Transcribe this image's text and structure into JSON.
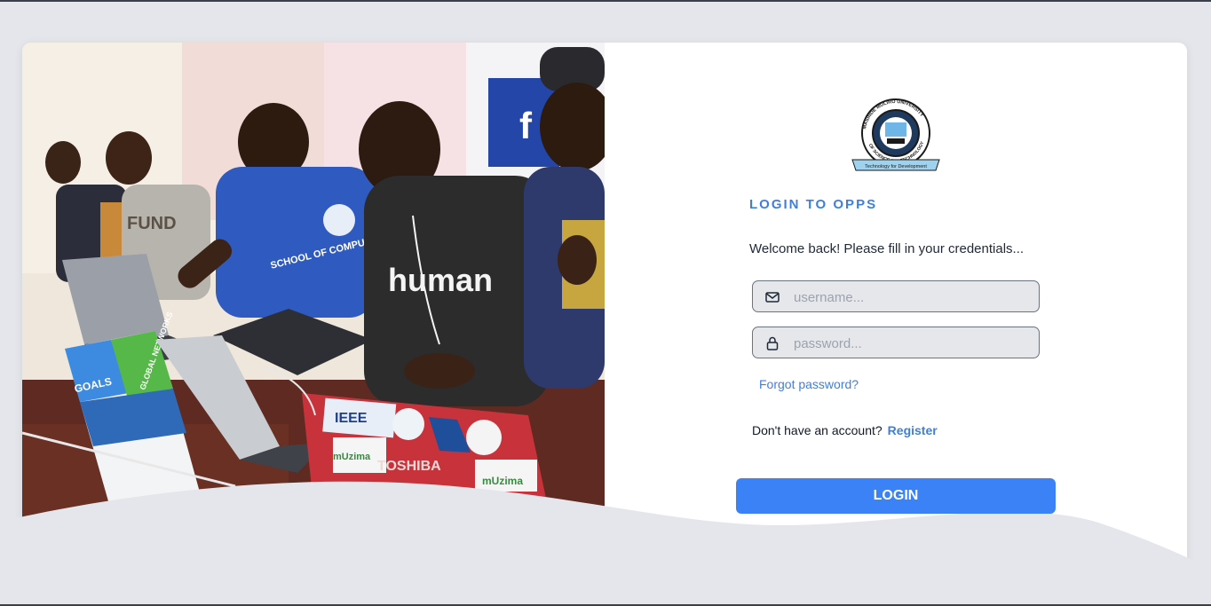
{
  "login": {
    "title": "LOGIN TO OPPS",
    "welcome": "Welcome back! Please fill in your credentials...",
    "username_placeholder": "username...",
    "password_placeholder": "password...",
    "forgot_password": "Forgot password?",
    "no_account": "Don't have an account?",
    "register": "Register",
    "submit": "LOGIN"
  },
  "logo": {
    "text_top": "MASINDE MULIRO UNIVERSITY",
    "text_bottom": "OF SCIENCE AND TECHNOLOGY",
    "motto": "Technology for Development"
  },
  "photo_text": {
    "shirt_human": "human",
    "shirt_school": "SCHOOL OF COMPUTING AND INFORMATICS",
    "shirt_fund": "FUND",
    "laptop_brand": "TOSHIBA",
    "sticker_ieee": "IEEE",
    "sticker_muzima": "mUzima",
    "sticker_muzima_2": "mUzima",
    "brochure": "GLOBAL NETWORKS",
    "brochure_goals": "GOALS"
  },
  "colors": {
    "accent": "#3d7fe0",
    "button": "#3b82f6",
    "background": "#e4e6eb",
    "input_bg": "#e5e7eb"
  },
  "icons": {
    "username": "mail-icon",
    "password": "lock-icon"
  }
}
